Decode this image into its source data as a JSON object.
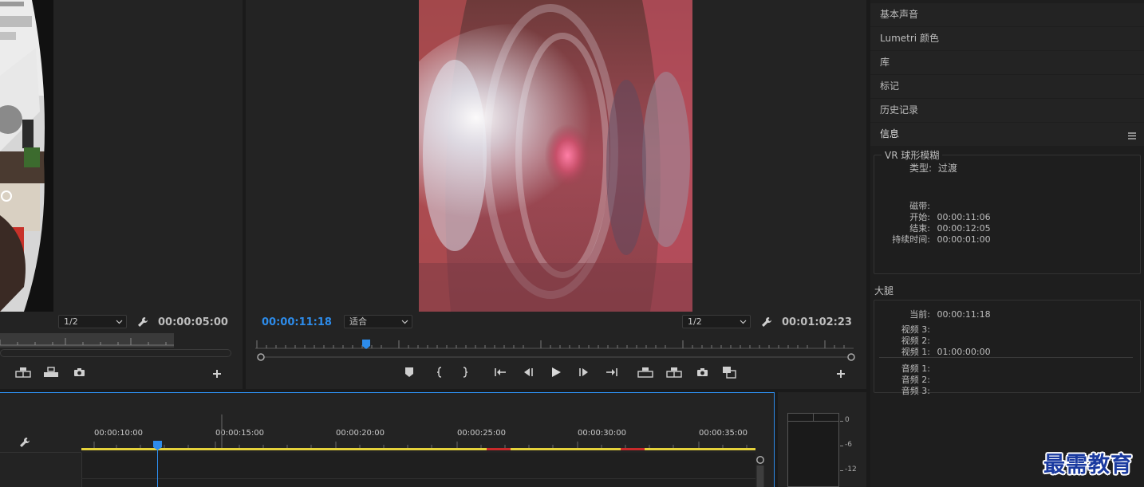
{
  "source_monitor": {
    "resolution": "1/2",
    "timecode": "00:00:05:00"
  },
  "program_monitor": {
    "current_timecode": "00:00:11:18",
    "fit": "适合",
    "resolution": "1/2",
    "duration": "00:01:02:23"
  },
  "right_panel": {
    "tabs": [
      "基本声音",
      "Lumetri 颜色",
      "库",
      "标记",
      "历史记录"
    ],
    "info_title": "信息",
    "effect": {
      "name": "VR 球形模糊",
      "type_label": "类型:",
      "type_value": "过渡",
      "tape_label": "磁带:",
      "start_label": "开始:",
      "start_value": "00:00:11:06",
      "end_label": "结束:",
      "end_value": "00:00:12:05",
      "duration_label": "持续时间:",
      "duration_value": "00:00:01:00"
    },
    "sequence": {
      "name": "大腿",
      "current_label": "当前:",
      "current_value": "00:00:11:18",
      "video3": "视频 3:",
      "video2": "视频 2:",
      "video1": "视频 1:",
      "video1_value": "01:00:00:00",
      "audio1": "音频 1:",
      "audio2": "音频 2:",
      "audio3": "音频 3:"
    }
  },
  "timeline": {
    "ruler_labels": [
      "00:00:10:00",
      "00:00:15:00",
      "00:00:20:00",
      "00:00:25:00",
      "00:00:30:00",
      "00:00:35:00"
    ]
  },
  "audio_meter": {
    "labels": [
      "0",
      "-6",
      "-12"
    ]
  },
  "watermark": "最需教育",
  "colors": {
    "accent": "#2d8ceb",
    "work_area": "#e5d23b",
    "render_red": "#c92a2a"
  }
}
